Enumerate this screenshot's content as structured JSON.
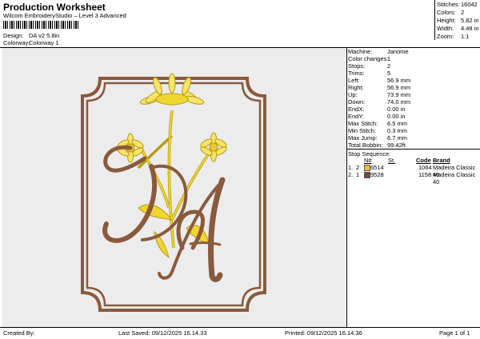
{
  "header": {
    "title": "Production Worksheet",
    "subtitle": "Wilcom EmbroideryStudio – Level 3 Advanced",
    "design_label": "Design:",
    "design_value": "DA v2 5.8in",
    "colorway_label": "Colorway:",
    "colorway_value": "Colorway 1"
  },
  "summary": [
    {
      "k": "Stitches:",
      "v": "16042"
    },
    {
      "k": "Colors:",
      "v": "2"
    },
    {
      "k": "Height:",
      "v": "5.82 in"
    },
    {
      "k": "Width:",
      "v": "4.48 in"
    },
    {
      "k": "Zoom:",
      "v": "1:1"
    }
  ],
  "properties": [
    {
      "k": "Machine:",
      "v": "Janome"
    },
    {
      "k": "Color changes:",
      "v": "1"
    },
    {
      "k": "Stops:",
      "v": "2"
    },
    {
      "k": "Trims:",
      "v": "5"
    },
    {
      "k": "Left:",
      "v": "56.9 mm"
    },
    {
      "k": "Right:",
      "v": "56.9 mm"
    },
    {
      "k": "Up:",
      "v": "73.9 mm"
    },
    {
      "k": "Down:",
      "v": "74.0 mm"
    },
    {
      "k": "EndX:",
      "v": "0.00 in"
    },
    {
      "k": "EndY:",
      "v": "0.00 in"
    },
    {
      "k": "Max Stitch:",
      "v": "6.5 mm"
    },
    {
      "k": "Min Stitch:",
      "v": "0.3 mm"
    },
    {
      "k": "Max Jump:",
      "v": "6.7 mm"
    },
    {
      "k": "Total Bobbin:",
      "v": "99.42ft"
    }
  ],
  "sequence": {
    "title": "Stop Sequence:",
    "headers": [
      "N#",
      "St.",
      "Code",
      "Brand"
    ],
    "rows": [
      {
        "idx": "1.",
        "n": "2",
        "color": "#e8c832",
        "st": "6514",
        "code": "1064",
        "brand": "Madeira Classic 40"
      },
      {
        "idx": "2.",
        "n": "1",
        "color": "#7a4a2e",
        "st": "9528",
        "code": "1158",
        "brand": "Madeira Classic 40"
      }
    ]
  },
  "footer": {
    "created": "Created By:",
    "saved": "Last Saved: 09/12/2025 16.14.33",
    "printed": "Printed: 09/12/2025 16.14.36",
    "page": "Page 1 of 1"
  },
  "colors": {
    "gold": "#f0d630",
    "gold_outline": "#b89a10",
    "brown": "#8a5a3c",
    "frame_bg": "#ececec"
  }
}
